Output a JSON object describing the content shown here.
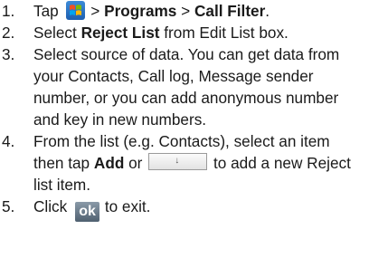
{
  "steps": [
    {
      "num": "1.",
      "text_tap": "Tap",
      "sep1": ">",
      "programs": "Programs",
      "sep2": ">",
      "call_filter": "Call Filter",
      "end": "."
    },
    {
      "num": "2.",
      "select": "Select",
      "reject_list": "Reject List",
      "rest": "from Edit List box."
    },
    {
      "num": "3.",
      "lines": [
        "Select source of data. You can get data from",
        "your Contacts, Call log, Message sender",
        "number, or you can add anonymous number",
        "and key in new numbers."
      ]
    },
    {
      "num": "4.",
      "line1": "From the list (e.g. Contacts), select an item",
      "then_tap": "then tap",
      "add": "Add",
      "or": "or",
      "to_add": "to add a new Reject",
      "line3": "list item."
    },
    {
      "num": "5.",
      "click": "Click",
      "ok_label": "ok",
      "to_exit": "to exit."
    }
  ],
  "icons": {
    "start": "windows-start-icon",
    "dropdown": "dropdown-button-icon",
    "ok": "ok-button-icon"
  }
}
